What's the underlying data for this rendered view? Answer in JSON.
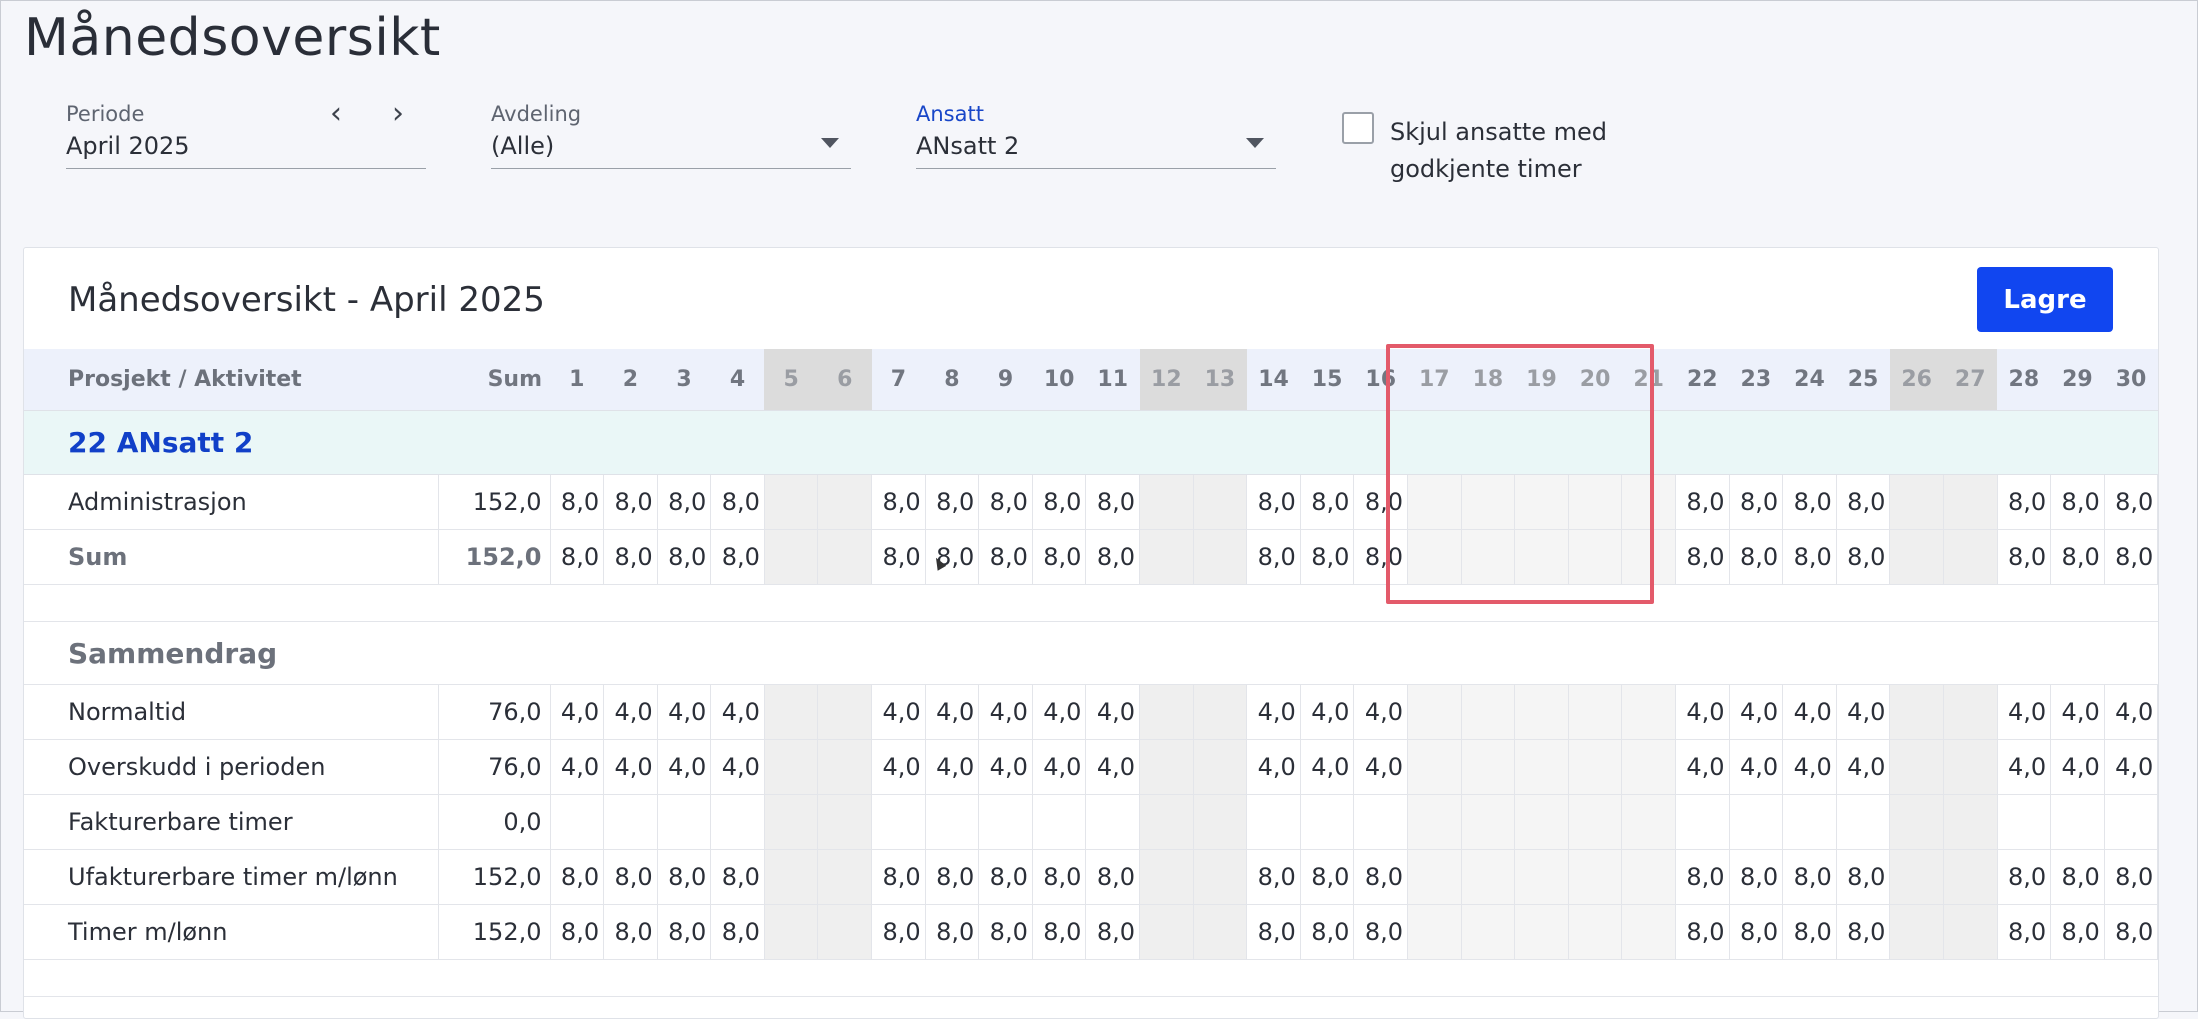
{
  "page": {
    "title": "Månedsoversikt"
  },
  "filters": {
    "period": {
      "label": "Periode",
      "value": "April 2025",
      "prev_icon": "‹",
      "next_icon": "›"
    },
    "department": {
      "label": "Avdeling",
      "value": "(Alle)"
    },
    "employee": {
      "label": "Ansatt",
      "value": "ANsatt 2"
    },
    "hide_approved": {
      "label": "Skjul ansatte med godkjente timer",
      "checked": false
    }
  },
  "card": {
    "title": "Månedsoversikt - April 2025",
    "save_label": "Lagre"
  },
  "table": {
    "col_project": "Prosjekt / Aktivitet",
    "col_sum": "Sum",
    "days": [
      "1",
      "2",
      "3",
      "4",
      "5",
      "6",
      "7",
      "8",
      "9",
      "10",
      "11",
      "12",
      "13",
      "14",
      "15",
      "16",
      "17",
      "18",
      "19",
      "20",
      "21",
      "22",
      "23",
      "24",
      "25",
      "26",
      "27",
      "28",
      "29",
      "30"
    ],
    "weekend_days": [
      5,
      6,
      12,
      13,
      26,
      27
    ],
    "holiday_days": [
      17,
      18,
      19,
      20,
      21
    ],
    "group_label": "22 ANsatt 2",
    "rows": [
      {
        "name": "Administrasjon",
        "sum": "152,0",
        "values": [
          "8,0",
          "8,0",
          "8,0",
          "8,0",
          "",
          "",
          "8,0",
          "8,0",
          "8,0",
          "8,0",
          "8,0",
          "",
          "",
          "8,0",
          "8,0",
          "8,0",
          "",
          "",
          "",
          "",
          "",
          "8,0",
          "8,0",
          "8,0",
          "8,0",
          "",
          "",
          "8,0",
          "8,0",
          "8,0"
        ]
      },
      {
        "name": "Sum",
        "sum": "152,0",
        "values": [
          "8,0",
          "8,0",
          "8,0",
          "8,0",
          "",
          "",
          "8,0",
          "8,0",
          "8,0",
          "8,0",
          "8,0",
          "",
          "",
          "8,0",
          "8,0",
          "8,0",
          "",
          "",
          "",
          "",
          "",
          "8,0",
          "8,0",
          "8,0",
          "8,0",
          "",
          "",
          "8,0",
          "8,0",
          "8,0"
        ]
      }
    ],
    "summary_label": "Sammendrag",
    "summary_rows": [
      {
        "name": "Normaltid",
        "sum": "76,0",
        "values": [
          "4,0",
          "4,0",
          "4,0",
          "4,0",
          "",
          "",
          "4,0",
          "4,0",
          "4,0",
          "4,0",
          "4,0",
          "",
          "",
          "4,0",
          "4,0",
          "4,0",
          "",
          "",
          "",
          "",
          "",
          "4,0",
          "4,0",
          "4,0",
          "4,0",
          "",
          "",
          "4,0",
          "4,0",
          "4,0"
        ]
      },
      {
        "name": "Overskudd i perioden",
        "sum": "76,0",
        "values": [
          "4,0",
          "4,0",
          "4,0",
          "4,0",
          "",
          "",
          "4,0",
          "4,0",
          "4,0",
          "4,0",
          "4,0",
          "",
          "",
          "4,0",
          "4,0",
          "4,0",
          "",
          "",
          "",
          "",
          "",
          "4,0",
          "4,0",
          "4,0",
          "4,0",
          "",
          "",
          "4,0",
          "4,0",
          "4,0"
        ]
      },
      {
        "name": "Fakturerbare timer",
        "sum": "0,0",
        "values": [
          "",
          "",
          "",
          "",
          "",
          "",
          "",
          "",
          "",
          "",
          "",
          "",
          "",
          "",
          "",
          "",
          "",
          "",
          "",
          "",
          "",
          "",
          "",
          "",
          "",
          "",
          "",
          "",
          "",
          ""
        ]
      },
      {
        "name": "Ufakturerbare timer m/lønn",
        "sum": "152,0",
        "values": [
          "8,0",
          "8,0",
          "8,0",
          "8,0",
          "",
          "",
          "8,0",
          "8,0",
          "8,0",
          "8,0",
          "8,0",
          "",
          "",
          "8,0",
          "8,0",
          "8,0",
          "",
          "",
          "",
          "",
          "",
          "8,0",
          "8,0",
          "8,0",
          "8,0",
          "",
          "",
          "8,0",
          "8,0",
          "8,0"
        ]
      },
      {
        "name": "Timer m/lønn",
        "sum": "152,0",
        "values": [
          "8,0",
          "8,0",
          "8,0",
          "8,0",
          "",
          "",
          "8,0",
          "8,0",
          "8,0",
          "8,0",
          "8,0",
          "",
          "",
          "8,0",
          "8,0",
          "8,0",
          "",
          "",
          "",
          "",
          "",
          "8,0",
          "8,0",
          "8,0",
          "8,0",
          "",
          "",
          "8,0",
          "8,0",
          "8,0"
        ]
      }
    ]
  },
  "colors": {
    "accent": "#1146f0",
    "highlight": "#e35a6a",
    "group_bg": "#eaf7f7",
    "header_bg": "#edf1fb",
    "weekend_bg": "#dcdcdc"
  }
}
